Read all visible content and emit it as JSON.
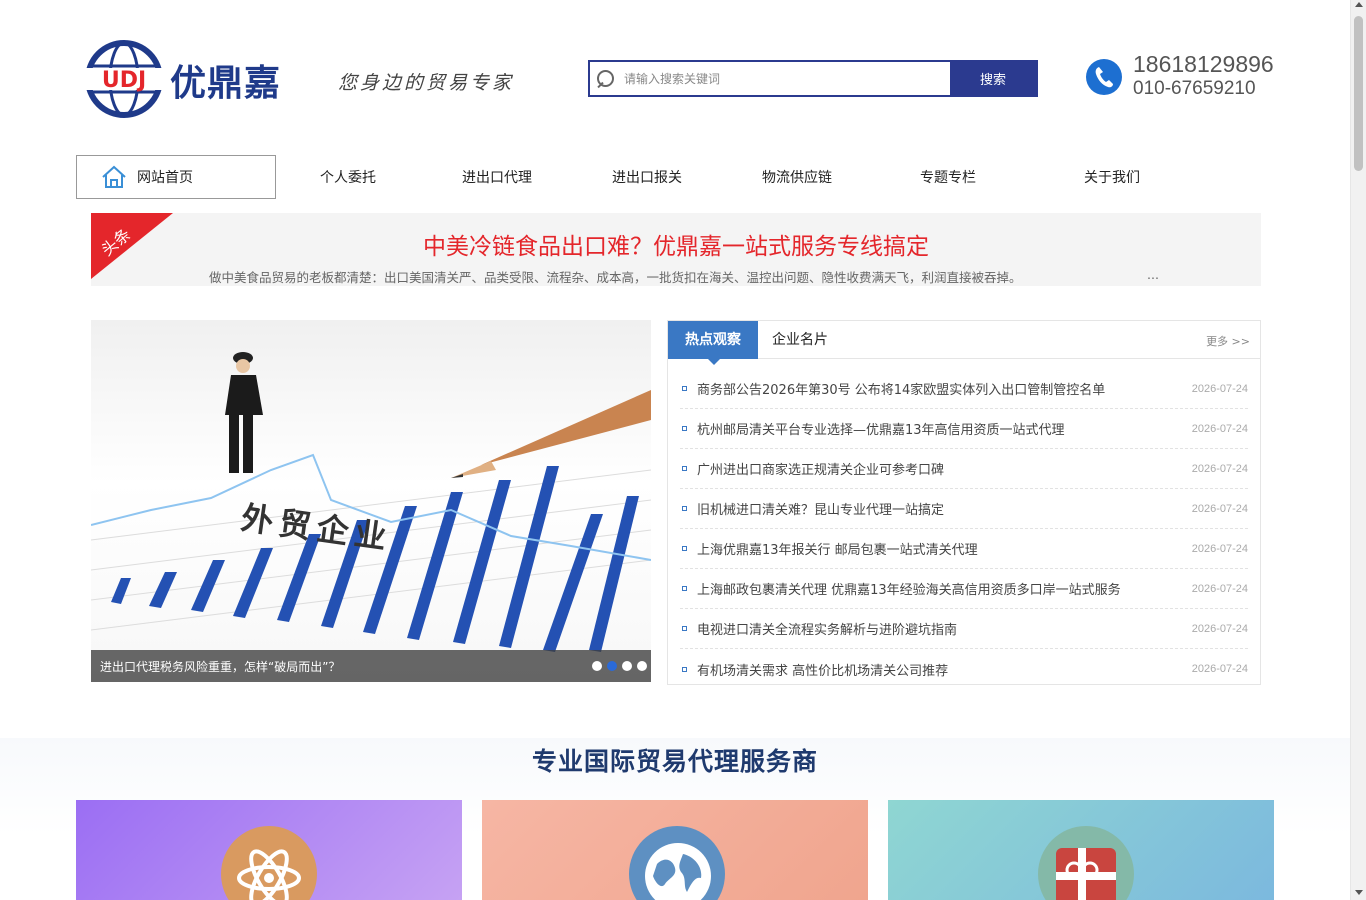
{
  "header": {
    "brand_name": "优鼎嘉",
    "logo_text": "UDJ",
    "slogan": "您身边的贸易专家",
    "search": {
      "placeholder": "请输入搜索关键词",
      "button_label": "搜索"
    },
    "phone_primary": "18618129896",
    "phone_secondary": "010-67659210"
  },
  "nav": {
    "home_label": "网站首页",
    "items": [
      {
        "label": "个人委托"
      },
      {
        "label": "进出口代理"
      },
      {
        "label": "进出口报关"
      },
      {
        "label": "物流供应链"
      },
      {
        "label": "专题专栏"
      },
      {
        "label": "关于我们"
      }
    ]
  },
  "headline": {
    "ribbon_label": "头条",
    "title": "中美冷链食品出口难？优鼎嘉一站式服务专线搞定",
    "summary": "做中美食品贸易的老板都清楚：出口美国清关严、品类受限、流程杂、成本高，一批货扣在海关、温控出问题、隐性收费满天飞，利润直接被吞掉。",
    "more": "..."
  },
  "slider": {
    "overlay_text": "外贸企业",
    "caption": "进出口代理税务风险重重，怎样“破局而出”？",
    "slide_count": 4,
    "active_index": 1
  },
  "news": {
    "tab_active": "热点观察",
    "tab_other": "企业名片",
    "more_label": "更多 >>",
    "items": [
      {
        "title": "商务部公告2026年第30号 公布将14家欧盟实体列入出口管制管控名单",
        "date": "2026-07-24"
      },
      {
        "title": "杭州邮局清关平台专业选择—优鼎嘉13年高信用资质一站式代理",
        "date": "2026-07-24"
      },
      {
        "title": "广州进出口商家选正规清关企业可参考口碑",
        "date": "2026-07-24"
      },
      {
        "title": "旧机械进口清关难？昆山专业代理一站搞定",
        "date": "2026-07-24"
      },
      {
        "title": "上海优鼎嘉13年报关行 邮局包裹一站式清关代理",
        "date": "2026-07-24"
      },
      {
        "title": "上海邮政包裹清关代理 优鼎嘉13年经验海关高信用资质多口岸一站式服务",
        "date": "2026-07-24"
      },
      {
        "title": "电视进口清关全流程实务解析与进阶避坑指南",
        "date": "2026-07-24"
      },
      {
        "title": "有机场清关需求 高性价比机场清关公司推荐",
        "date": "2026-07-24"
      }
    ]
  },
  "section": {
    "title": "专业国际贸易代理服务商",
    "cards": [
      {
        "icon": "atom-icon"
      },
      {
        "icon": "globe-icon"
      },
      {
        "icon": "gift-icon"
      }
    ]
  },
  "colors": {
    "brand_blue": "#2b3a8f",
    "accent_red": "#e4262b",
    "tab_blue": "#3a78c4"
  }
}
